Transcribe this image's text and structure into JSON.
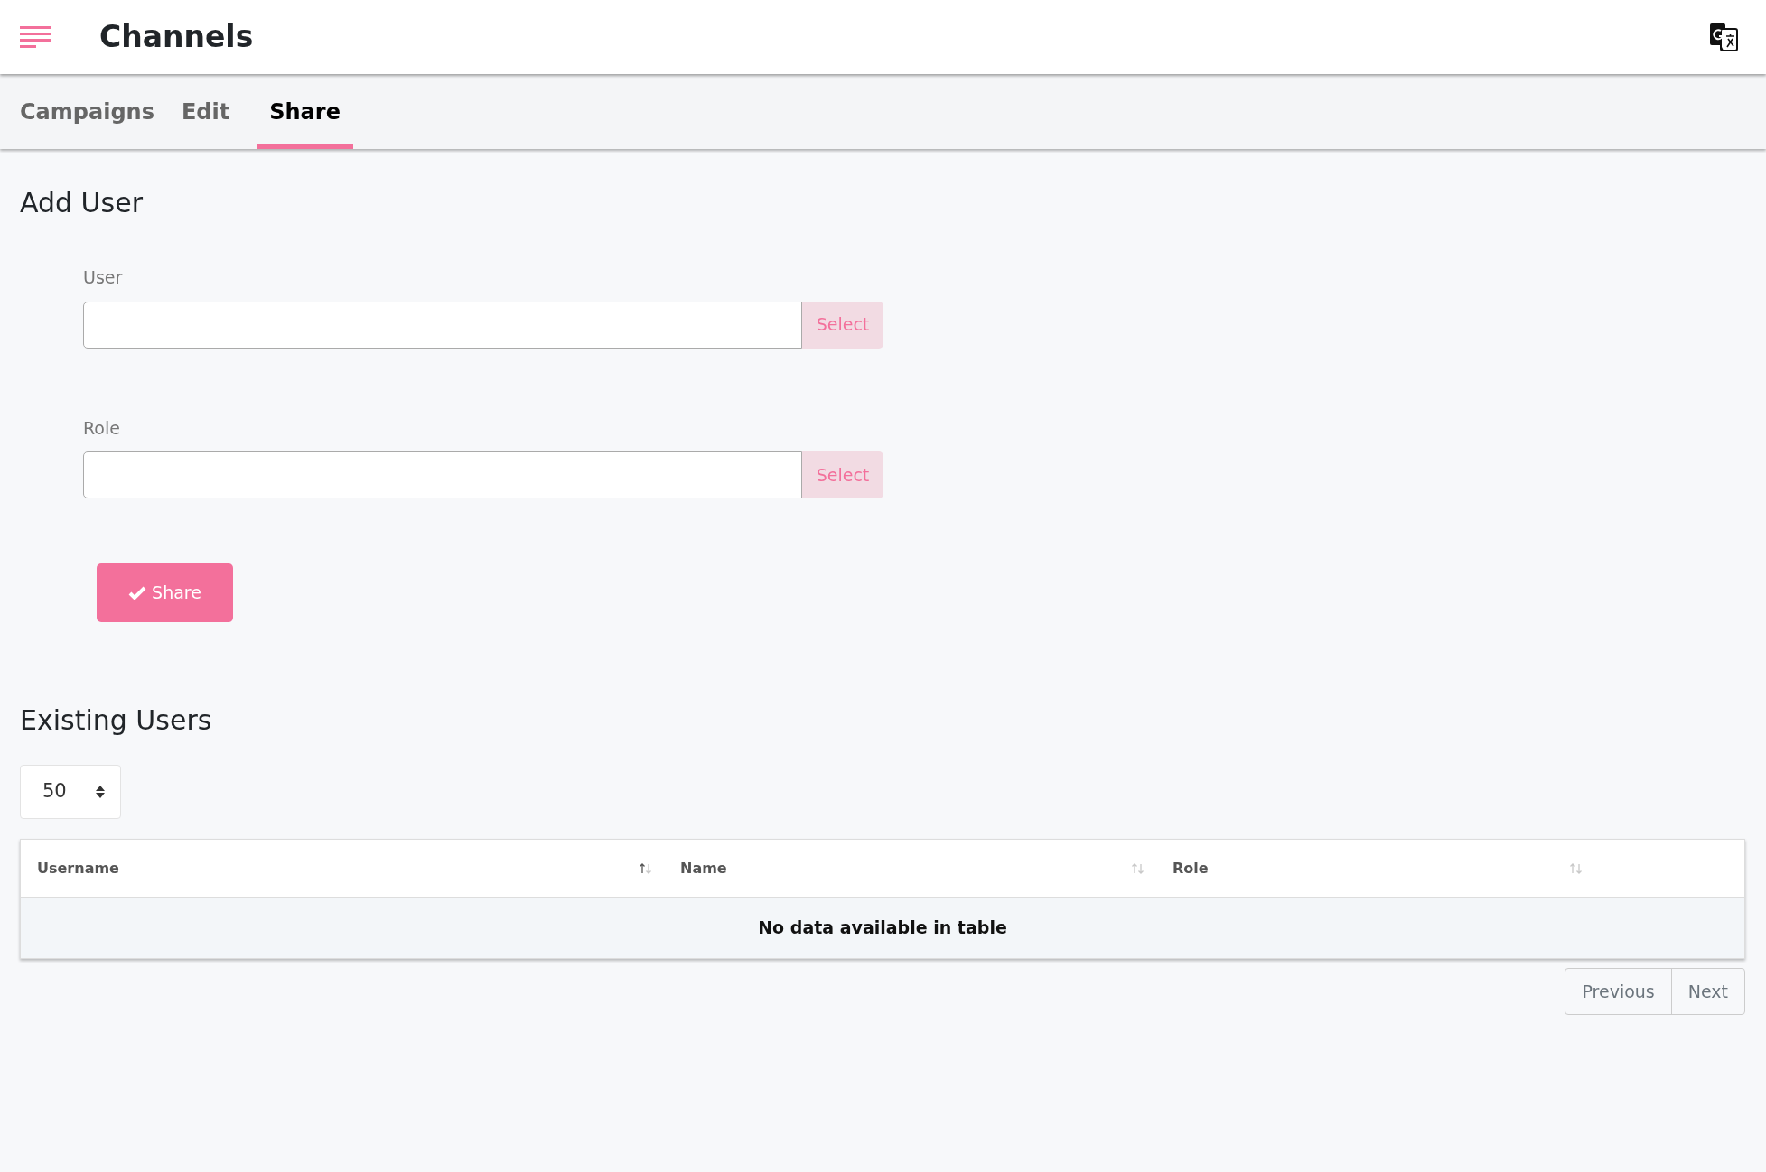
{
  "header": {
    "title": "Channels"
  },
  "tabs": [
    {
      "label": "Campaigns",
      "selected": false
    },
    {
      "label": "Edit",
      "selected": false
    },
    {
      "label": "Share",
      "selected": true
    }
  ],
  "add_user": {
    "heading": "Add User",
    "fields": [
      {
        "label": "User",
        "button": "Select"
      },
      {
        "label": "Role",
        "button": "Select"
      }
    ],
    "submit": "Share"
  },
  "existing_users": {
    "heading": "Existing Users",
    "page_size": "50",
    "table": {
      "columns": [
        {
          "label": "Username",
          "sorted": true
        },
        {
          "label": "Name",
          "sorted": false
        },
        {
          "label": "Role",
          "sorted": false
        }
      ],
      "empty_message": "No data available in table"
    },
    "pagination": [
      "Previous",
      "Next"
    ]
  }
}
